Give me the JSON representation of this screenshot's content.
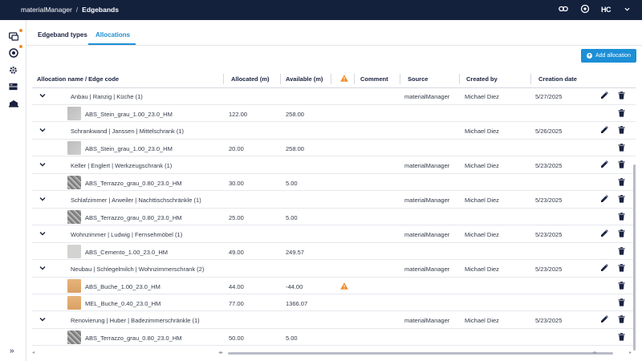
{
  "header": {
    "app": "materialManager",
    "separator": "/",
    "page": "Edgebands",
    "logo": "HC"
  },
  "tabs": [
    {
      "label": "Edgeband types"
    },
    {
      "label": "Allocations"
    }
  ],
  "add_button": {
    "label": "Add allocation"
  },
  "columns": {
    "name": "Allocation name / Edge code",
    "allocated": "Allocated (m)",
    "available": "Available (m)",
    "comment": "Comment",
    "source": "Source",
    "created_by": "Created by",
    "creation_date": "Creation date"
  },
  "rows": [
    {
      "kind": "group",
      "name": "Anbau | Ranzig | Küche (1)",
      "source": "materialManager",
      "created_by": "Michael Diez",
      "date": "5/27/2025"
    },
    {
      "kind": "child",
      "code": "ABS_Stein_grau_1.00_23.0_HM",
      "thumb": "stone",
      "allocated": "122.00",
      "available": "258.00",
      "warn": false
    },
    {
      "kind": "group",
      "name": "Schrankwand | Janssen | Mittelschrank (1)",
      "source": "",
      "created_by": "Michael Diez",
      "date": "5/26/2025"
    },
    {
      "kind": "child",
      "code": "ABS_Stein_grau_1.00_23.0_HM",
      "thumb": "stone",
      "allocated": "20.00",
      "available": "258.00",
      "warn": false
    },
    {
      "kind": "group",
      "name": "Keller | Englert | Werkzeugschrank (1)",
      "source": "materialManager",
      "created_by": "Michael Diez",
      "date": "5/23/2025"
    },
    {
      "kind": "child",
      "code": "ABS_Terrazzo_grau_0.80_23.0_HM",
      "thumb": "terrazzo",
      "allocated": "30.00",
      "available": "5.00",
      "warn": false
    },
    {
      "kind": "group",
      "name": "Schlafzimmer | Arweiler | Nachttischschränkle (1)",
      "source": "materialManager",
      "created_by": "Michael Diez",
      "date": "5/23/2025"
    },
    {
      "kind": "child",
      "code": "ABS_Terrazzo_grau_0.80_23.0_HM",
      "thumb": "terrazzo",
      "allocated": "25.00",
      "available": "5.00",
      "warn": false
    },
    {
      "kind": "group",
      "name": "Wohnzimmer | Ludwig | Fernsehmöbel (1)",
      "source": "materialManager",
      "created_by": "Michael Diez",
      "date": "5/23/2025"
    },
    {
      "kind": "child",
      "code": "ABS_Cemento_1.00_23.0_HM",
      "thumb": "cemento",
      "allocated": "49.00",
      "available": "249.57",
      "warn": false
    },
    {
      "kind": "group",
      "name": "Neubau | Schlegelmilch | Wohnzimmerschrank (2)",
      "source": "materialManager",
      "created_by": "Michael Diez",
      "date": "5/23/2025"
    },
    {
      "kind": "child",
      "code": "ABS_Buche_1.00_23.0_HM",
      "thumb": "buche",
      "allocated": "44.00",
      "available": "-44.00",
      "warn": true
    },
    {
      "kind": "child",
      "code": "MEL_Buche_0.40_23.0_HM",
      "thumb": "buche",
      "allocated": "77.00",
      "available": "1366.07",
      "warn": false
    },
    {
      "kind": "group",
      "name": "Renovierung | Huber | Badezimmerschränkle (1)",
      "source": "materialManager",
      "created_by": "Michael Diez",
      "date": "5/23/2025"
    },
    {
      "kind": "child",
      "code": "ABS_Terrazzo_grau_0.80_23.0_HM",
      "thumb": "terrazzo",
      "allocated": "50.00",
      "available": "5.00",
      "warn": false
    }
  ],
  "colors": {
    "topbar": "#14213d",
    "accent": "#1c8fd6",
    "warning": "#f28c28"
  }
}
